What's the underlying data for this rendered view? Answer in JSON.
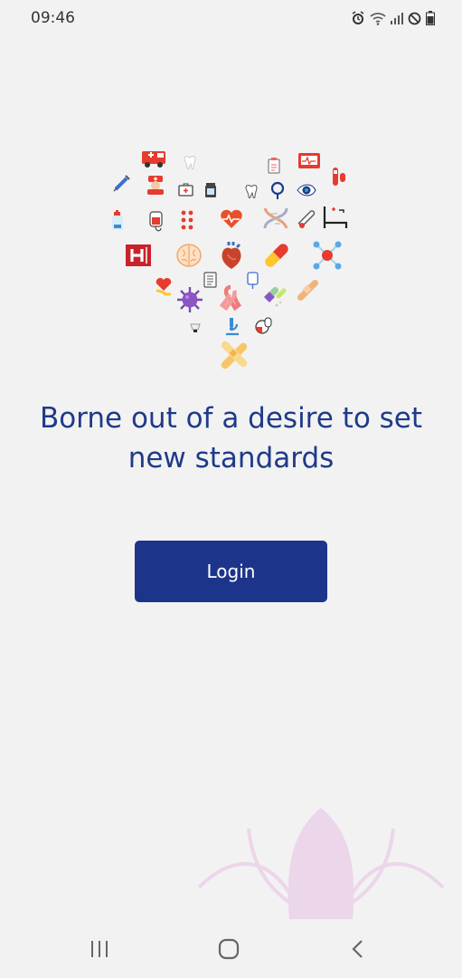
{
  "status_bar": {
    "time": "09:46",
    "icons": [
      "alarm-icon",
      "wifi-icon",
      "signal-icon",
      "do-not-disturb-icon",
      "battery-icon"
    ]
  },
  "heart_icons": [
    "ambulance-icon",
    "tooth-icon",
    "clipboard-icon",
    "monitor-icon",
    "syringe-icon",
    "nurse-icon",
    "first-aid-kit-icon",
    "medicine-bottle-icon",
    "tooth-icon",
    "stethoscope-icon",
    "eye-icon",
    "test-tubes-icon",
    "pill-bottle-icon",
    "blood-bag-icon",
    "pills-icon",
    "heart-rate-icon",
    "dna-icon",
    "thermometer-icon",
    "hospital-bed-icon",
    "hospital-icon",
    "brain-icon",
    "heart-organ-icon",
    "capsule-icon",
    "molecule-icon",
    "heart-hand-icon",
    "document-icon",
    "iv-drip-icon",
    "virus-icon",
    "ribbon-icon",
    "capsules-icon",
    "bandage-icon",
    "light-icon",
    "microscope-icon",
    "pill-icon",
    "bandage-cross-icon"
  ],
  "headline": {
    "line1": "Borne out of a desire to set",
    "line2": "new standards"
  },
  "login_label": "Login",
  "nav_bar": {
    "recents": "recents-icon",
    "home": "home-icon",
    "back": "back-icon"
  },
  "colors": {
    "background": "#f2f2f2",
    "headline": "#1f3a88",
    "button": "#1c358b",
    "lotus": "#ecd6ea"
  }
}
